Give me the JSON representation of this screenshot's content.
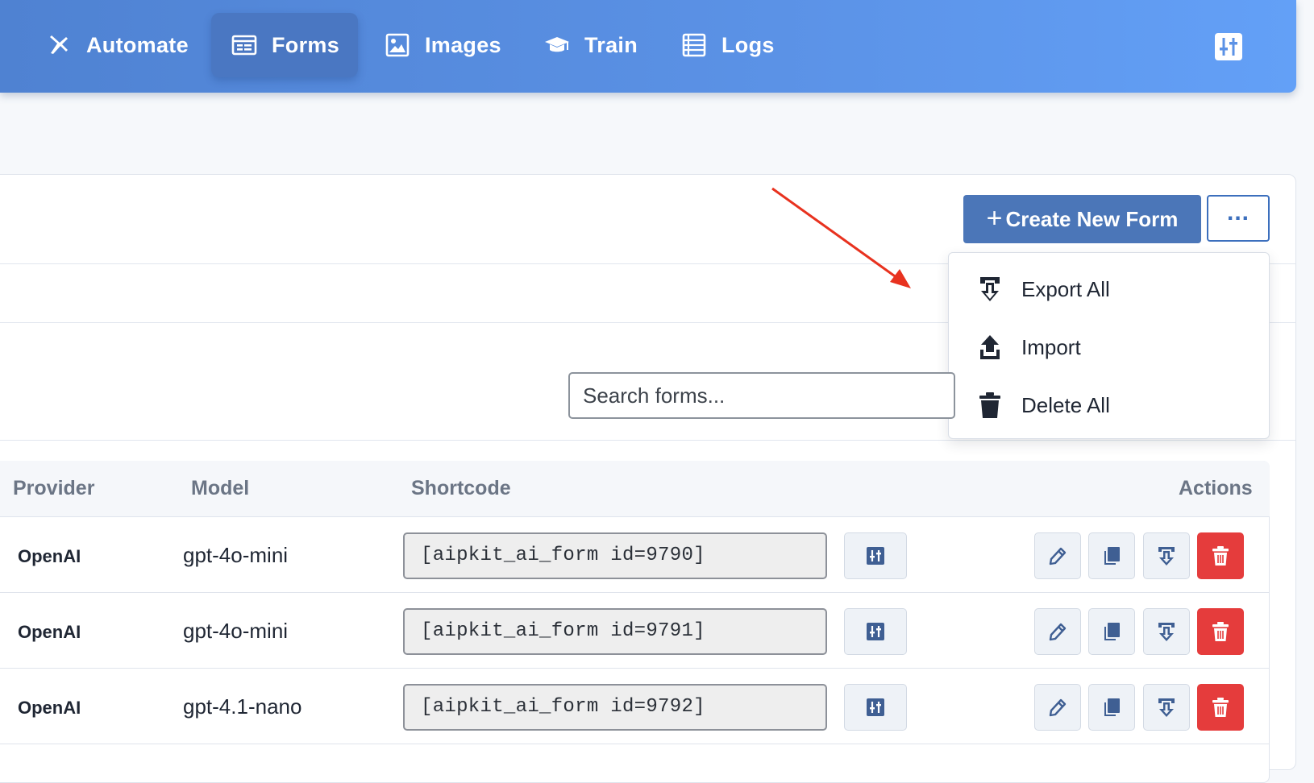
{
  "nav": {
    "items": [
      {
        "label": "Automate",
        "icon": "plane-icon",
        "active": false
      },
      {
        "label": "Forms",
        "icon": "form-icon",
        "active": true
      },
      {
        "label": "Images",
        "icon": "image-icon",
        "active": false
      },
      {
        "label": "Train",
        "icon": "graduation-cap-icon",
        "active": false
      },
      {
        "label": "Logs",
        "icon": "list-icon",
        "active": false
      }
    ],
    "settings_icon": "settings-sliders-icon"
  },
  "toolbar": {
    "create_label": "Create New Form",
    "more_label": "...",
    "more_icon": "ellipsis-icon"
  },
  "dropdown": {
    "items": [
      {
        "label": "Export All",
        "icon": "download-icon"
      },
      {
        "label": "Import",
        "icon": "upload-icon"
      },
      {
        "label": "Delete All",
        "icon": "trash-icon"
      }
    ]
  },
  "search": {
    "placeholder": "Search forms..."
  },
  "table": {
    "headers": {
      "provider": "Provider",
      "model": "Model",
      "shortcode": "Shortcode",
      "actions": "Actions"
    },
    "rows": [
      {
        "provider": "OpenAI",
        "model": "gpt-4o-mini",
        "shortcode": "[aipkit_ai_form id=9790]"
      },
      {
        "provider": "OpenAI",
        "model": "gpt-4o-mini",
        "shortcode": "[aipkit_ai_form id=9791]"
      },
      {
        "provider": "OpenAI",
        "model": "gpt-4.1-nano",
        "shortcode": "[aipkit_ai_form id=9792]"
      }
    ],
    "row_actions": [
      "edit-icon",
      "duplicate-icon",
      "export-icon",
      "delete-icon"
    ]
  },
  "colors": {
    "nav_gradient_start": "#4f82d2",
    "nav_gradient_end": "#63a0f7",
    "primary_button": "#4b76b8",
    "delete_button": "#e53c3c",
    "annotation_arrow": "#e8321f"
  }
}
